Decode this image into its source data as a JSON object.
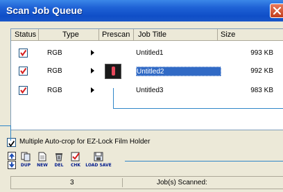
{
  "window": {
    "title": "Scan Job Queue"
  },
  "columns": {
    "status": "Status",
    "type": "Type",
    "prescan": "Prescan",
    "job_title": "Job Title",
    "size": "Size"
  },
  "jobs": [
    {
      "checked": true,
      "type": "RGB",
      "title": "Untitled1",
      "size": "993 KB",
      "selected": false,
      "prescan": false
    },
    {
      "checked": true,
      "type": "RGB",
      "title": "Untitled2",
      "size": "992 KB",
      "selected": true,
      "prescan": true
    },
    {
      "checked": true,
      "type": "RGB",
      "title": "Untitled3",
      "size": "983 KB",
      "selected": false,
      "prescan": false
    }
  ],
  "options": {
    "multiple_autocrop_label": "Multiple Auto-crop for EZ-Lock Film Holder",
    "multiple_autocrop_checked": true
  },
  "toolbar": {
    "dup": "DUP",
    "new": "NEW",
    "del": "DEL",
    "chk": "CHK",
    "load_save": "LOAD SAVE"
  },
  "status": {
    "count": "3",
    "text": "Job(s) Scanned:"
  },
  "colors": {
    "titlebar": "#0f4ec7",
    "selection": "#316ac5",
    "check_mark": "#d61f1f",
    "callout": "#2f86c8"
  }
}
